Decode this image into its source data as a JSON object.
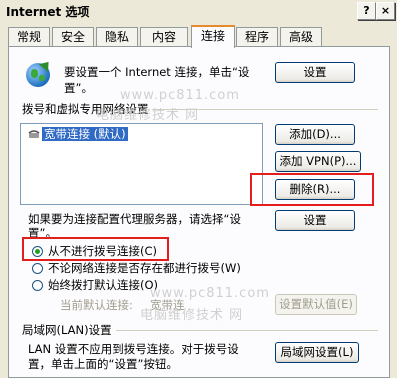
{
  "window": {
    "title": "Internet 选项",
    "help_btn": "?",
    "close_btn": "×"
  },
  "tabs": [
    "常规",
    "安全",
    "隐私",
    "内容",
    "连接",
    "程序",
    "高级"
  ],
  "active_tab": "连接",
  "setup": {
    "text_line1": "要设置一个 Internet 连接，单击“设",
    "text_line2": "置”。",
    "button": "设置"
  },
  "dialup": {
    "group_label": "拨号和虚拟专用网络设置",
    "items": [
      {
        "label": "宽带连接 (默认)"
      }
    ],
    "add_button": "添加(D)...",
    "add_vpn_button": "添加 VPN(P)...",
    "delete_button": "删除(R)...",
    "settings_button": "设置",
    "proxy_text_line1": "如果要为连接配置代理服务器，请选择“设",
    "proxy_text_line2": "置”。",
    "options": [
      {
        "label": "从不进行拨号连接(C)",
        "selected": true
      },
      {
        "label": "不论网络连接是否存在都进行拨号(W)",
        "selected": false
      },
      {
        "label": "始终拨打默认连接(O)",
        "selected": false
      }
    ],
    "current_default_label": "当前默认连接:",
    "current_default_value": "宽带连",
    "set_default_button": "设置默认值(E)"
  },
  "lan": {
    "group_label": "局域网(LAN)设置",
    "text_line1": "LAN 设置不应用到拨号连接。对于拨号设",
    "text_line2": "置，单击上面的“设置”按钮。",
    "button": "局域网设置(L)"
  },
  "watermarks": [
    "www.pc811.com",
    "电脑维修技术 网",
    "www.pc811.com",
    "电脑维修技术 网"
  ]
}
